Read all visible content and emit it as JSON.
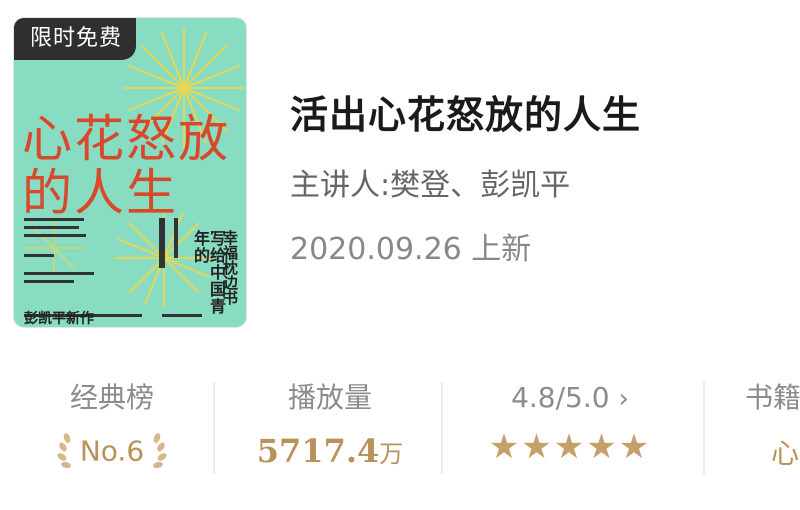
{
  "badge": "限时免费",
  "cover": {
    "title_line1": "心花怒放",
    "title_line2": "的人生",
    "vertical_text": "写给中国青年的",
    "vertical_text2": "幸福枕边书",
    "author": "彭凯平新作"
  },
  "book": {
    "title": "活出心花怒放的人生",
    "speaker": "主讲人:樊登、彭凯平",
    "date": "2020.09.26 上新"
  },
  "stats": {
    "rank": {
      "label": "经典榜",
      "value": "No.6"
    },
    "plays": {
      "label": "播放量",
      "number": "5717.4",
      "unit": "万"
    },
    "rating": {
      "label": "4.8/5.0",
      "chevron": "›",
      "stars": "★★★★★",
      "value": 4.8,
      "max": 5.0
    },
    "category": {
      "label": "书籍",
      "value": "心"
    }
  },
  "colors": {
    "accent_gold": "#b8925a",
    "cover_bg": "#88dcc2",
    "cover_title": "#d8492c",
    "badge_bg": "#2f2f2f"
  }
}
